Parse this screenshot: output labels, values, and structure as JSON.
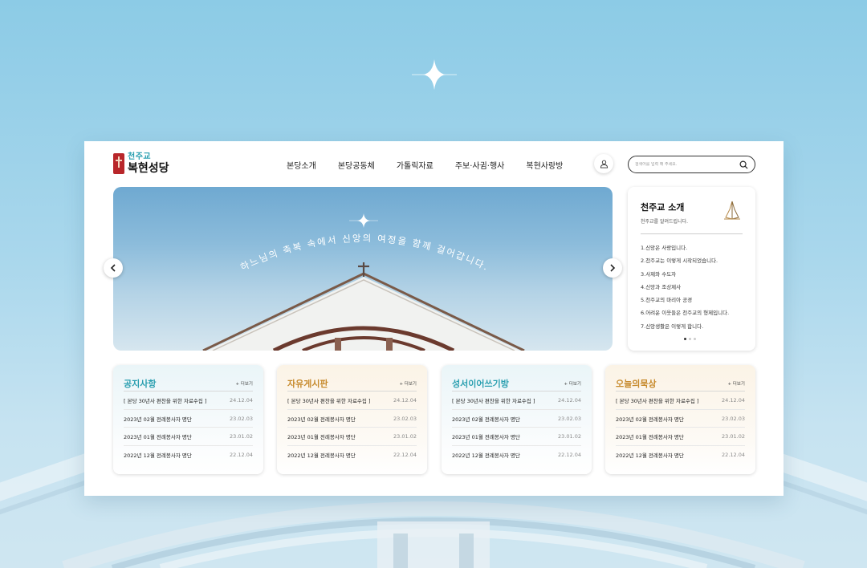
{
  "logo": {
    "sub": "천주교",
    "main": "복현성당"
  },
  "nav": [
    "본당소개",
    "본당공동체",
    "가톨릭자료",
    "주보·사귐·행사",
    "복현사랑방"
  ],
  "search": {
    "placeholder": "검색어를 입력 해 주세요."
  },
  "hero": {
    "caption": "하느님의 축복 속에서 신앙의 여정을 함께 걸어갑니다."
  },
  "intro": {
    "title": "천주교 소개",
    "subtitle": "천주교를 알려드립니다.",
    "items": [
      "1.신앙은 사랑입니다.",
      "2.천주교는 이렇게 시작되었습니다.",
      "3.사제와 수도자",
      "4.신앙과 조상제사",
      "5.천주교의 마리아 공경",
      "6.어려운 이웃들은 천주교의 형제입니다.",
      "7.신앙생활은 이렇게 합니다."
    ],
    "active_slide": 1,
    "slide_count": 3
  },
  "boards": [
    {
      "title": "공지사항",
      "more": "+ 더보기",
      "rows": [
        {
          "title": "[ 본당 30년사 편찬을 위한 자료수집 ]",
          "date": "24.12.04"
        },
        {
          "title": "2023년 02월 전례봉사자 명단",
          "date": "23.02.03"
        },
        {
          "title": "2023년 01월 전례봉사자 명단",
          "date": "23.01.02"
        },
        {
          "title": "2022년 12월 전례봉사자 명단",
          "date": "22.12.04"
        }
      ]
    },
    {
      "title": "자유게시판",
      "more": "+ 더보기",
      "rows": [
        {
          "title": "[ 본당 30년사 편찬을 위한 자료수집 ]",
          "date": "24.12.04"
        },
        {
          "title": "2023년 02월 전례봉사자 명단",
          "date": "23.02.03"
        },
        {
          "title": "2023년 01월 전례봉사자 명단",
          "date": "23.01.02"
        },
        {
          "title": "2022년 12월 전례봉사자 명단",
          "date": "22.12.04"
        }
      ]
    },
    {
      "title": "성서이어쓰기방",
      "more": "+ 더보기",
      "rows": [
        {
          "title": "[ 본당 30년사 편찬을 위한 자료수집 ]",
          "date": "24.12.04"
        },
        {
          "title": "2023년 02월 전례봉사자 명단",
          "date": "23.02.03"
        },
        {
          "title": "2023년 01월 전례봉사자 명단",
          "date": "23.01.02"
        },
        {
          "title": "2022년 12월 전례봉사자 명단",
          "date": "22.12.04"
        }
      ]
    },
    {
      "title": "오늘의묵상",
      "more": "+ 더보기",
      "rows": [
        {
          "title": "[ 본당 30년사 편찬을 위한 자료수집 ]",
          "date": "24.12.04"
        },
        {
          "title": "2023년 02월 전례봉사자 명단",
          "date": "23.02.03"
        },
        {
          "title": "2023년 01월 전례봉사자 명단",
          "date": "23.01.02"
        },
        {
          "title": "2022년 12월 전례봉사자 명단",
          "date": "22.12.04"
        }
      ]
    }
  ],
  "colors": {
    "accent_teal": "#2a9fb0",
    "accent_gold": "#c78a2c",
    "logo_red": "#b8262a"
  },
  "icons": {
    "user": "user-icon",
    "search": "search-icon",
    "prev": "chevron-left-icon",
    "next": "chevron-right-icon",
    "hands": "praying-hands-icon",
    "sparkle": "sparkle-icon"
  }
}
